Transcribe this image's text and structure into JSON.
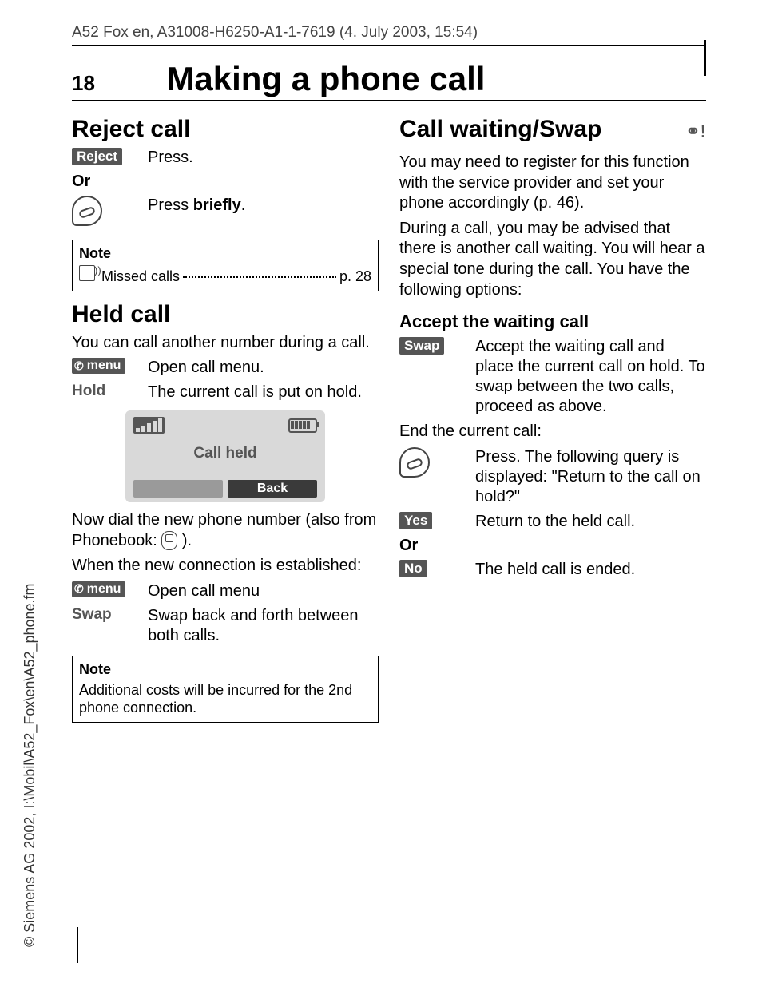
{
  "header": "A52 Fox en, A31008-H6250-A1-1-7619 (4. July 2003, 15:54)",
  "page_number": "18",
  "page_title": "Making a phone call",
  "copyright": "© Siemens AG 2002, I:\\Mobil\\A52_Fox\\en\\A52_phone.fm",
  "left": {
    "h_reject": "Reject call",
    "reject_key": "Reject",
    "reject_desc": "Press.",
    "or": "Or",
    "press_briefly_pre": "Press ",
    "press_briefly_bold": "briefly",
    "press_briefly_post": ".",
    "note1_title": "Note",
    "note1_item": "Missed calls",
    "note1_page": "p. 28",
    "h_held": "Held call",
    "held_intro": "You can call another number during a call.",
    "menu_key": "menu",
    "menu_desc": "Open call menu.",
    "hold_label": "Hold",
    "hold_desc": "The current call is put on hold.",
    "screen_text": "Call held",
    "screen_back": "Back",
    "now_dial": "Now dial the new phone number (also from Phonebook: ",
    "now_dial_end": " ).",
    "when_conn": "When the new connection is established:",
    "menu_desc2": "Open call menu",
    "swap_label": "Swap",
    "swap_desc": "Swap back and forth between both calls.",
    "note2_title": "Note",
    "note2_body": "Additional costs will be incurred for the 2nd phone connection."
  },
  "right": {
    "h_wait": "Call waiting/Swap",
    "net_icon": "⚭!",
    "p1": "You may need to register for this function with the service provider and set your phone accordingly (p. 46).",
    "p2": "During a call, you may be advised that there is another call waiting. You will hear a special tone during the call. You have the following options:",
    "h_accept": "Accept the waiting call",
    "swap_key": "Swap",
    "swap_desc": "Accept the waiting call and place the current call on hold. To swap between the two calls, proceed as above.",
    "end_current": "End the current call:",
    "end_desc": "Press. The following query is displayed: \"Return to the call on hold?\"",
    "yes_key": "Yes",
    "yes_desc": "Return to the held call.",
    "or": "Or",
    "no_key": "No",
    "no_desc": "The held call is ended."
  }
}
